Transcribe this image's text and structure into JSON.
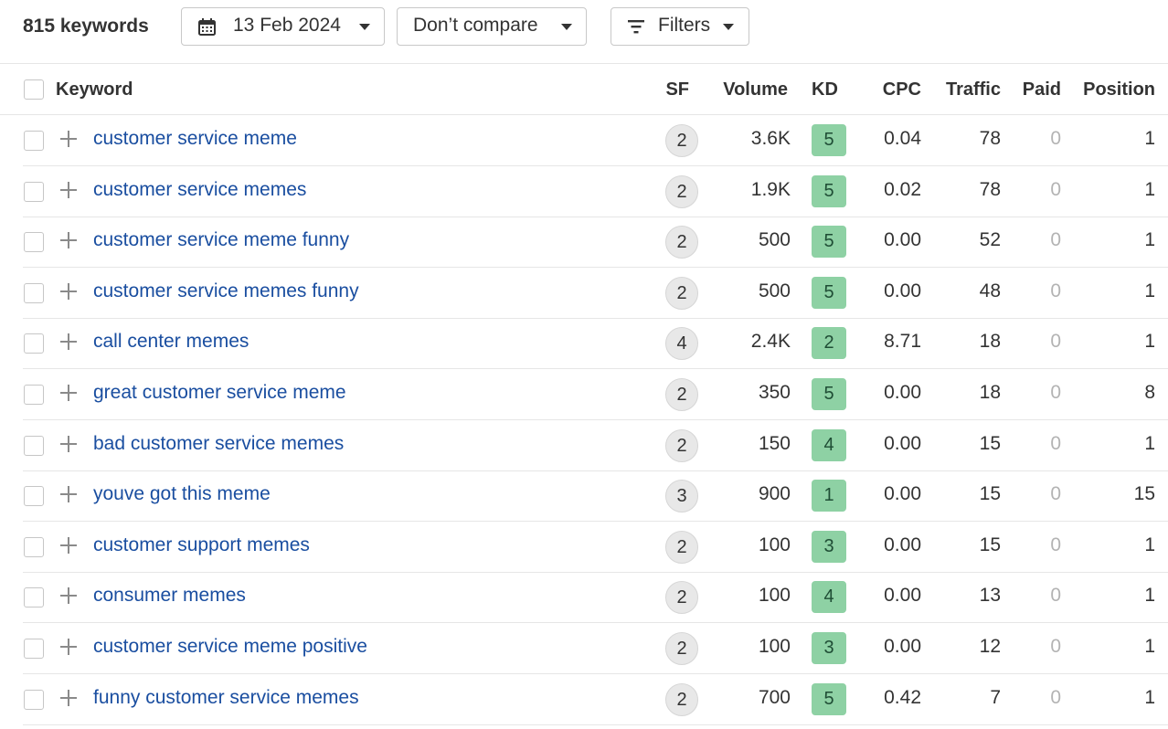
{
  "toolbar": {
    "keyword_count": "815 keywords",
    "date_label": "13 Feb 2024",
    "compare_label": "Don’t compare",
    "filters_label": "Filters"
  },
  "table": {
    "columns": {
      "keyword": "Keyword",
      "sf": "SF",
      "volume": "Volume",
      "kd": "KD",
      "cpc": "CPC",
      "traffic": "Traffic",
      "paid": "Paid",
      "position": "Position"
    },
    "rows": [
      {
        "keyword": "customer service meme",
        "sf": "2",
        "volume": "3.6K",
        "kd": "5",
        "cpc": "0.04",
        "traffic": "78",
        "paid": "0",
        "position": "1"
      },
      {
        "keyword": "customer service memes",
        "sf": "2",
        "volume": "1.9K",
        "kd": "5",
        "cpc": "0.02",
        "traffic": "78",
        "paid": "0",
        "position": "1"
      },
      {
        "keyword": "customer service meme funny",
        "sf": "2",
        "volume": "500",
        "kd": "5",
        "cpc": "0.00",
        "traffic": "52",
        "paid": "0",
        "position": "1"
      },
      {
        "keyword": "customer service memes funny",
        "sf": "2",
        "volume": "500",
        "kd": "5",
        "cpc": "0.00",
        "traffic": "48",
        "paid": "0",
        "position": "1"
      },
      {
        "keyword": "call center memes",
        "sf": "4",
        "volume": "2.4K",
        "kd": "2",
        "cpc": "8.71",
        "traffic": "18",
        "paid": "0",
        "position": "1"
      },
      {
        "keyword": "great customer service meme",
        "sf": "2",
        "volume": "350",
        "kd": "5",
        "cpc": "0.00",
        "traffic": "18",
        "paid": "0",
        "position": "8"
      },
      {
        "keyword": "bad customer service memes",
        "sf": "2",
        "volume": "150",
        "kd": "4",
        "cpc": "0.00",
        "traffic": "15",
        "paid": "0",
        "position": "1"
      },
      {
        "keyword": "youve got this meme",
        "sf": "3",
        "volume": "900",
        "kd": "1",
        "cpc": "0.00",
        "traffic": "15",
        "paid": "0",
        "position": "15"
      },
      {
        "keyword": "customer support memes",
        "sf": "2",
        "volume": "100",
        "kd": "3",
        "cpc": "0.00",
        "traffic": "15",
        "paid": "0",
        "position": "1"
      },
      {
        "keyword": "consumer memes",
        "sf": "2",
        "volume": "100",
        "kd": "4",
        "cpc": "0.00",
        "traffic": "13",
        "paid": "0",
        "position": "1"
      },
      {
        "keyword": "customer service meme positive",
        "sf": "2",
        "volume": "100",
        "kd": "3",
        "cpc": "0.00",
        "traffic": "12",
        "paid": "0",
        "position": "1"
      },
      {
        "keyword": "funny customer service memes",
        "sf": "2",
        "volume": "700",
        "kd": "5",
        "cpc": "0.42",
        "traffic": "7",
        "paid": "0",
        "position": "1"
      }
    ]
  },
  "colors": {
    "link": "#1a4ea0",
    "kd_badge": "#8ed1a4",
    "paid_zero": "#b3b3b3",
    "sf_badge": "#e8e8e8"
  }
}
